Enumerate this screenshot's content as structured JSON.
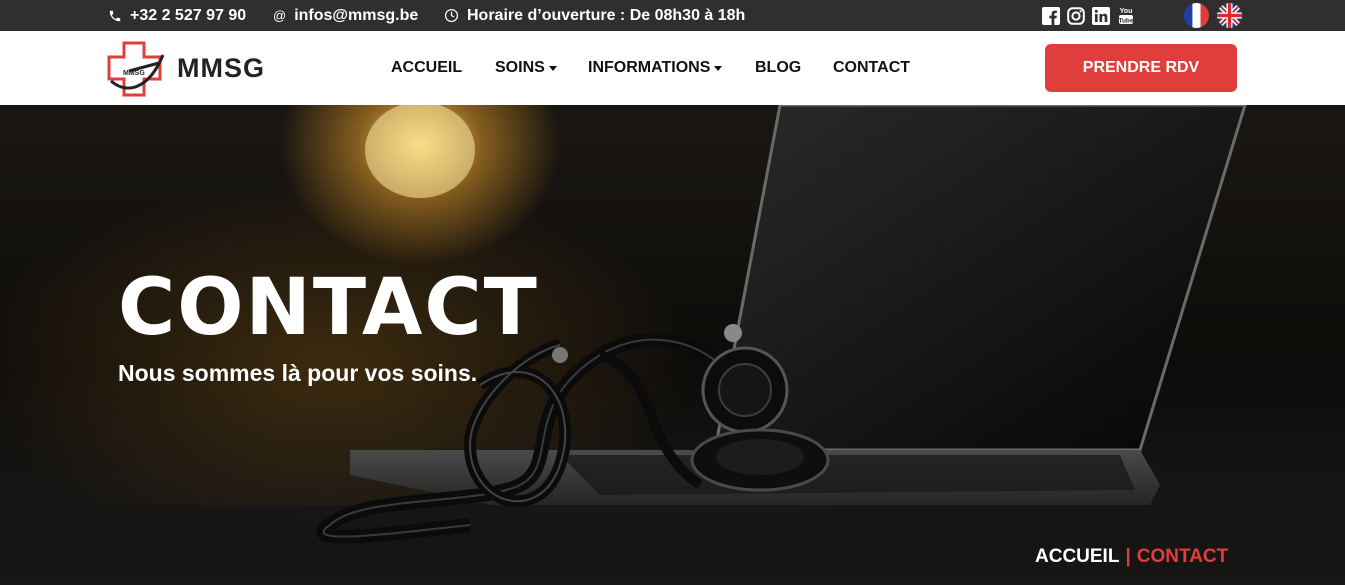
{
  "topbar": {
    "phone": "+32 2 527 97 90",
    "email": "infos@mmsg.be",
    "hours": "Horaire d’ouverture : De 08h30 à 18h",
    "social_icons": [
      "facebook-icon",
      "instagram-icon",
      "linkedin-icon",
      "youtube-icon"
    ],
    "languages": [
      "fr-flag",
      "en-flag"
    ]
  },
  "nav": {
    "brand": "MMSG",
    "logo_text": "MMSG",
    "items": [
      {
        "label": "ACCUEIL"
      },
      {
        "label": "SOINS"
      },
      {
        "label": "INFORMATIONS"
      },
      {
        "label": "BLOG"
      },
      {
        "label": "CONTACT"
      }
    ],
    "cta": "PRENDRE RDV"
  },
  "hero": {
    "title": "CONTACT",
    "subtitle": "Nous sommes là pour vos soins.",
    "breadcrumb": {
      "home": "ACCUEIL",
      "separator": "|",
      "current": "CONTACT"
    }
  },
  "colors": {
    "accent": "#e03d3d",
    "topbar": "#2f2f2f"
  }
}
